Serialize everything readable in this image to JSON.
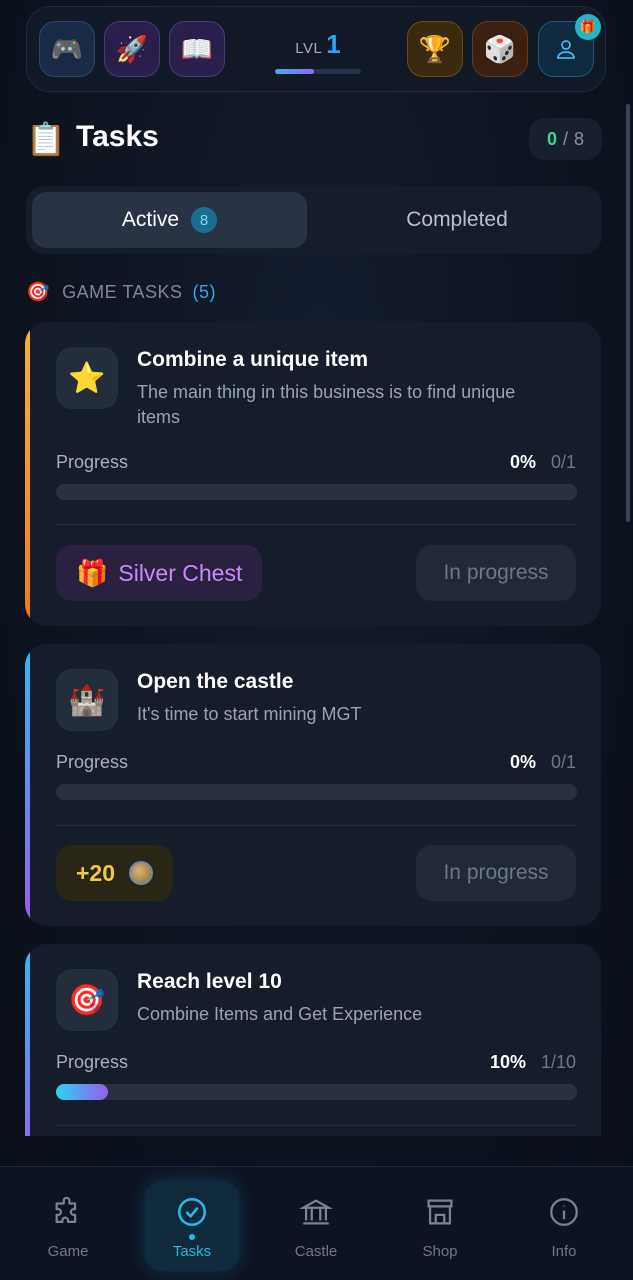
{
  "topbar": {
    "level_label": "LVL",
    "level_value": "1",
    "level_progress": 0.45,
    "icons": [
      "gamepad-icon",
      "rocket-icon",
      "book-icon",
      "trophy-icon",
      "dice-icon",
      "user-icon",
      "gift-icon"
    ]
  },
  "header": {
    "title": "Tasks",
    "icon": "clipboard-icon",
    "completed": "0",
    "separator": "/",
    "total": "8"
  },
  "tabs": {
    "active_label": "Active",
    "active_count": "8",
    "completed_label": "Completed"
  },
  "section": {
    "title": "GAME TASKS",
    "count": "(5)"
  },
  "tasks": [
    {
      "icon": "star-icon",
      "title": "Combine a unique item",
      "description": "The main thing in this business is to find unique items",
      "progress_label": "Progress",
      "percent": "0%",
      "count": "0/1",
      "progress": 0,
      "reward": "Silver Chest",
      "reward_icon": "gift-icon",
      "status": "In progress",
      "accent": "#f2a13a"
    },
    {
      "icon": "castle-icon",
      "title": "Open the castle",
      "description": "It's time to start mining MGT",
      "progress_label": "Progress",
      "percent": "0%",
      "count": "0/1",
      "progress": 0,
      "reward": "+20",
      "reward_icon": "coin-icon",
      "status": "In progress",
      "accent": "#3aa8f0"
    },
    {
      "icon": "target-icon",
      "title": "Reach level 10",
      "description": "Combine Items and Get Experience",
      "progress_label": "Progress",
      "percent": "10%",
      "count": "1/10",
      "progress": 0.1,
      "accent": "#3aa8f0"
    }
  ],
  "nav": {
    "game": "Game",
    "tasks": "Tasks",
    "castle": "Castle",
    "shop": "Shop",
    "info": "Info"
  }
}
